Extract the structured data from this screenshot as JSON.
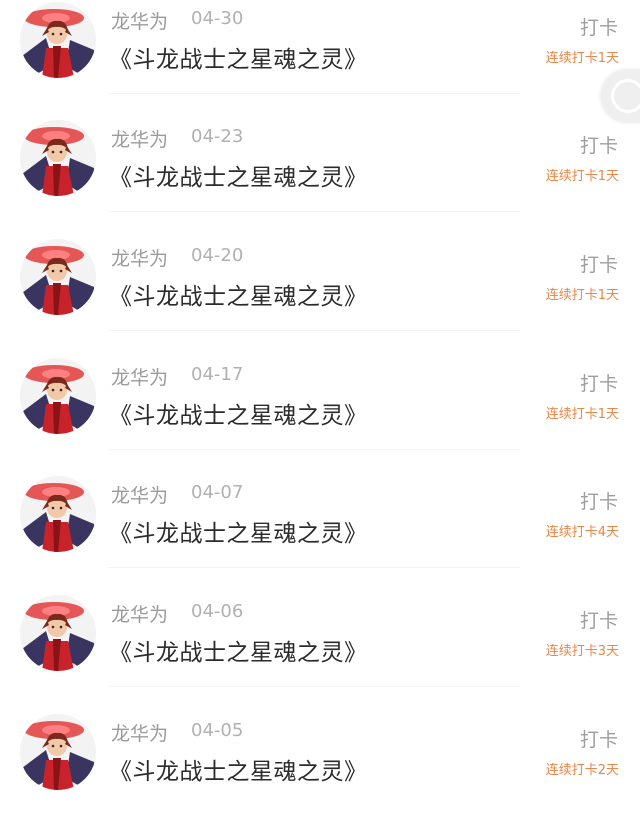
{
  "feed": {
    "entries": [
      {
        "user": "龙华为",
        "date": "04-30",
        "title": "《斗龙战士之星魂之灵》",
        "checkin": "打卡",
        "streak": "连续打卡1天"
      },
      {
        "user": "龙华为",
        "date": "04-23",
        "title": "《斗龙战士之星魂之灵》",
        "checkin": "打卡",
        "streak": "连续打卡1天"
      },
      {
        "user": "龙华为",
        "date": "04-20",
        "title": "《斗龙战士之星魂之灵》",
        "checkin": "打卡",
        "streak": "连续打卡1天"
      },
      {
        "user": "龙华为",
        "date": "04-17",
        "title": "《斗龙战士之星魂之灵》",
        "checkin": "打卡",
        "streak": "连续打卡1天"
      },
      {
        "user": "龙华为",
        "date": "04-07",
        "title": "《斗龙战士之星魂之灵》",
        "checkin": "打卡",
        "streak": "连续打卡4天"
      },
      {
        "user": "龙华为",
        "date": "04-06",
        "title": "《斗龙战士之星魂之灵》",
        "checkin": "打卡",
        "streak": "连续打卡3天"
      },
      {
        "user": "龙华为",
        "date": "04-05",
        "title": "《斗龙战士之星魂之灵》",
        "checkin": "打卡",
        "streak": "连续打卡2天"
      }
    ]
  },
  "icons": {
    "avatar": "anime-character-avatar-icon",
    "scroll_handle": "scroll-handle-icon"
  },
  "colors": {
    "streak": "#e8874a",
    "username": "#9b9b9b",
    "title": "#2b2b2b"
  }
}
